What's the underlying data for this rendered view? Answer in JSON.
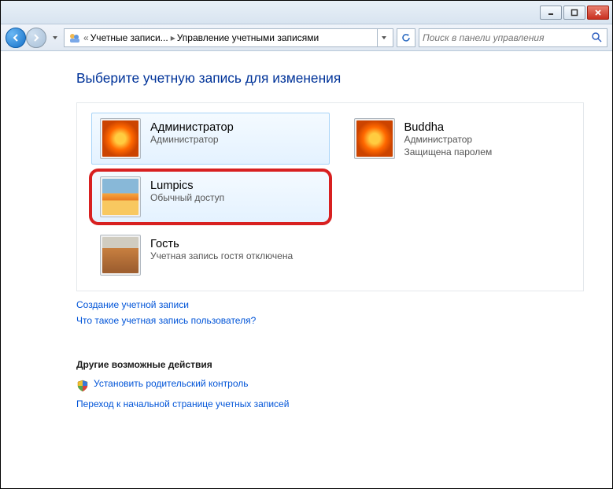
{
  "breadcrumb": {
    "seg1": "Учетные записи...",
    "seg2": "Управление учетными записями"
  },
  "search": {
    "placeholder": "Поиск в панели управления"
  },
  "page": {
    "title": "Выберите учетную запись для изменения"
  },
  "accounts": [
    {
      "name": "Администратор",
      "line1": "Администратор",
      "line2": ""
    },
    {
      "name": "Buddha",
      "line1": "Администратор",
      "line2": "Защищена паролем"
    },
    {
      "name": "Lumpics",
      "line1": "Обычный доступ",
      "line2": ""
    },
    {
      "name": "Гость",
      "line1": "Учетная запись гостя отключена",
      "line2": ""
    }
  ],
  "links": {
    "create": "Создание учетной записи",
    "what": "Что такое учетная запись пользователя?"
  },
  "actions": {
    "title": "Другие возможные действия",
    "parental": "Установить родительский контроль",
    "mainpage": "Переход к начальной странице учетных записей"
  }
}
